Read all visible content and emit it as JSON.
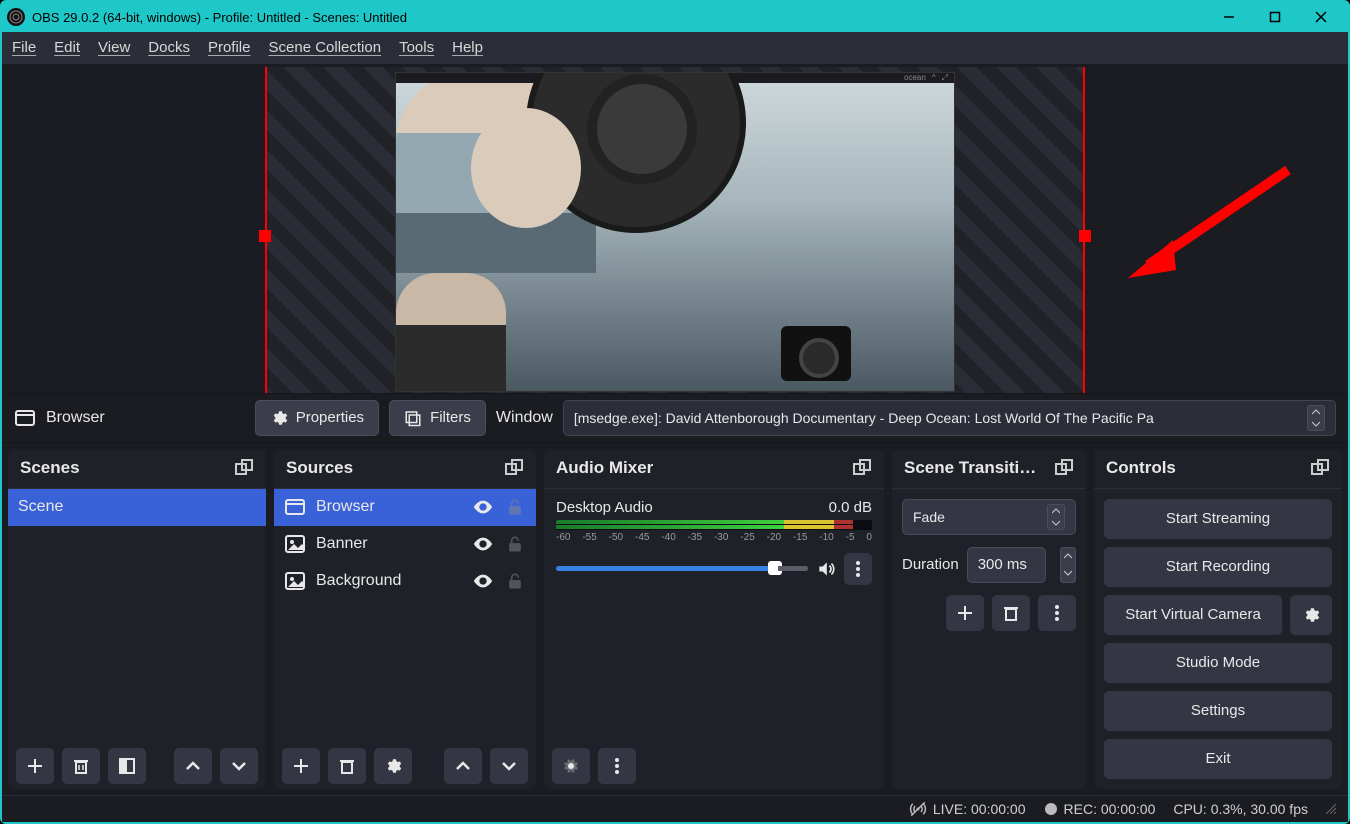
{
  "title": "OBS 29.0.2 (64-bit, windows) - Profile: Untitled - Scenes: Untitled",
  "menu": [
    "File",
    "Edit",
    "View",
    "Docks",
    "Profile",
    "Scene Collection",
    "Tools",
    "Help"
  ],
  "midbar": {
    "source_label": "Browser",
    "properties": "Properties",
    "filters": "Filters",
    "window_label": "Window",
    "window_value": "[msedge.exe]: David Attenborough Documentary - Deep Ocean: Lost World Of The Pacific Pa"
  },
  "dock_titles": {
    "scenes": "Scenes",
    "sources": "Sources",
    "mixer": "Audio Mixer",
    "transitions": "Scene Transiti…",
    "controls": "Controls"
  },
  "scenes": [
    {
      "name": "Scene",
      "selected": true
    }
  ],
  "sources": [
    {
      "name": "Browser",
      "icon": "window",
      "selected": true,
      "visible": true,
      "locked": false
    },
    {
      "name": "Banner",
      "icon": "image",
      "selected": false,
      "visible": true,
      "locked": false
    },
    {
      "name": "Background",
      "icon": "image",
      "selected": false,
      "visible": true,
      "locked": false
    }
  ],
  "mixer": {
    "track_name": "Desktop Audio",
    "db_value": "0.0 dB",
    "ticks": [
      "-60",
      "-55",
      "-50",
      "-45",
      "-40",
      "-35",
      "-30",
      "-25",
      "-20",
      "-15",
      "-10",
      "-5",
      "0"
    ]
  },
  "transitions": {
    "type": "Fade",
    "duration_label": "Duration",
    "duration_value": "300 ms"
  },
  "controls": {
    "start_streaming": "Start Streaming",
    "start_recording": "Start Recording",
    "virtual_camera": "Start Virtual Camera",
    "studio_mode": "Studio Mode",
    "settings": "Settings",
    "exit": "Exit"
  },
  "status": {
    "live": "LIVE: 00:00:00",
    "rec": "REC: 00:00:00",
    "cpu": "CPU: 0.3%, 30.00 fps"
  }
}
